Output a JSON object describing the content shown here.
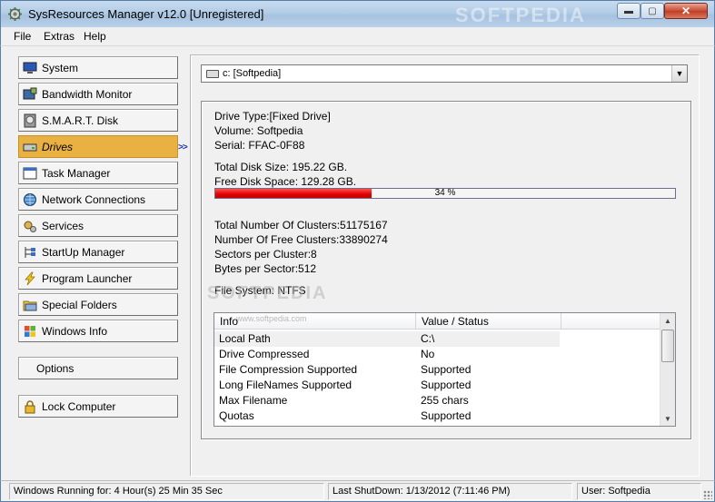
{
  "window": {
    "title": "SysResources Manager  v12.0 [Unregistered]",
    "min_glyph": "▬",
    "max_glyph": "▢",
    "close_glyph": "✕",
    "watermark": "SOFTPEDIA"
  },
  "menu": [
    "File",
    "Extras",
    "Help"
  ],
  "sidebar": {
    "items": [
      {
        "label": "System",
        "icon": "monitor-icon"
      },
      {
        "label": "Bandwidth Monitor",
        "icon": "network-card-icon"
      },
      {
        "label": "S.M.A.R.T. Disk",
        "icon": "hard-disk-icon"
      },
      {
        "label": "Drives",
        "icon": "drive-icon",
        "active": true
      },
      {
        "label": "Task Manager",
        "icon": "task-window-icon"
      },
      {
        "label": "Network Connections",
        "icon": "globe-icon"
      },
      {
        "label": "Services",
        "icon": "gears-icon"
      },
      {
        "label": "StartUp Manager",
        "icon": "startup-tree-icon"
      },
      {
        "label": "Program Launcher",
        "icon": "lightning-icon"
      },
      {
        "label": "Special Folders",
        "icon": "folders-icon"
      },
      {
        "label": "Windows Info",
        "icon": "windows-flag-icon"
      }
    ],
    "options_label": "Options",
    "lock_label": "Lock Computer",
    "active_marker": ">>"
  },
  "drive_select": {
    "value": "c: [Softpedia]",
    "dropdown_glyph": "▼"
  },
  "drive_info": {
    "drive_type": "Drive Type:[Fixed Drive]",
    "volume": "Volume: Softpedia",
    "serial": "Serial: FFAC-0F88",
    "total_size": "Total Disk Size: 195.22 GB.",
    "free_space": "Free Disk Space: 129.28 GB.",
    "used_percent_label": "34 %",
    "used_fraction": 0.34,
    "total_clusters": "Total Number Of Clusters:51175167",
    "free_clusters": "Number Of Free Clusters:33890274",
    "sectors_per_cluster": "Sectors per Cluster:8",
    "bytes_per_sector": "Bytes per Sector:512",
    "file_system": "File System: NTFS",
    "watermark": "SOFTPEDIA",
    "watermark_url": "www.softpedia.com"
  },
  "table": {
    "headers": [
      "Info",
      "Value / Status"
    ],
    "rows": [
      [
        "Local Path",
        "C:\\"
      ],
      [
        "Drive Compressed",
        "No"
      ],
      [
        "File Compression Supported",
        "Supported"
      ],
      [
        "Long FileNames Supported",
        "Supported"
      ],
      [
        "Max Filename",
        "255 chars"
      ],
      [
        "Quotas",
        "Supported"
      ]
    ],
    "scroll_up": "▲",
    "scroll_down": "▼"
  },
  "status": {
    "uptime": "Windows Running for: 4 Hour(s) 25 Min 35 Sec",
    "last_shutdown": "Last ShutDown: 1/13/2012 (7:11:46 PM)",
    "user": "User: Softpedia"
  },
  "colors": {
    "active_nav": "#e9b142",
    "progress": "#e00000",
    "marker": "#2233aa"
  }
}
